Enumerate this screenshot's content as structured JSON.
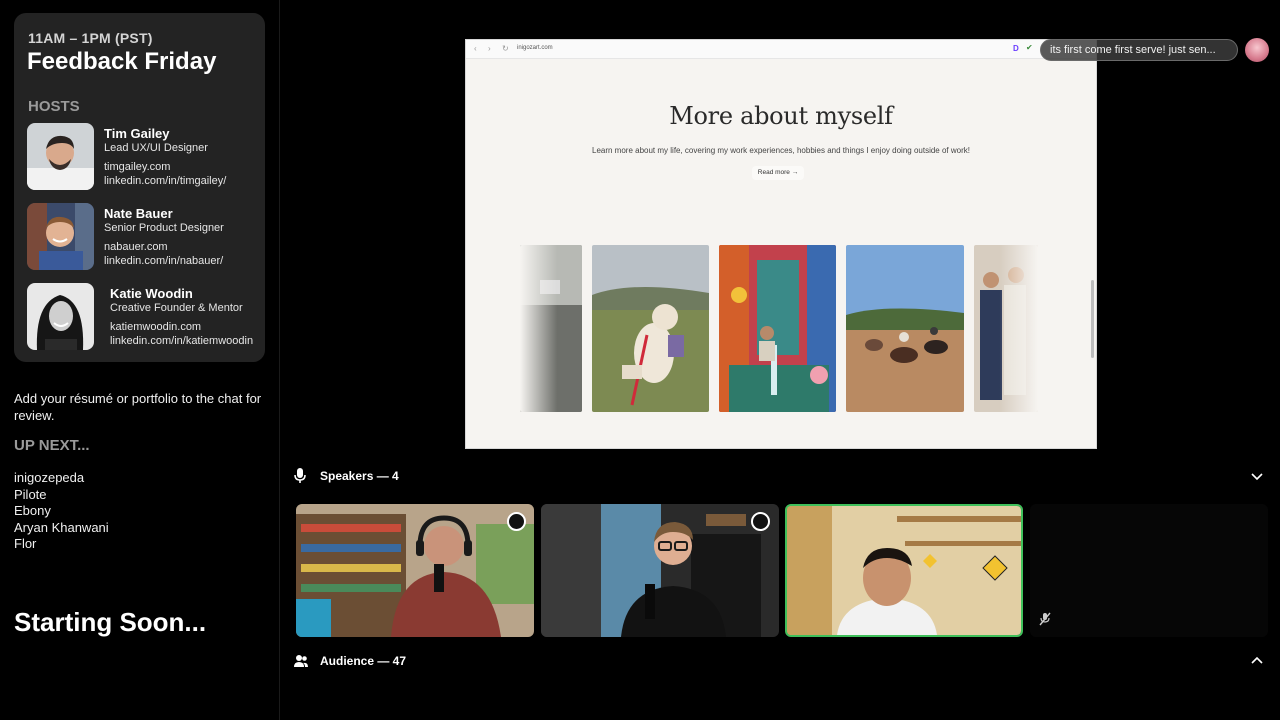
{
  "event": {
    "time": "11AM – 1PM (PST)",
    "title": "Feedback Friday",
    "hosts_heading": "HOSTS",
    "hosts": [
      {
        "name": "Tim Gailey",
        "role": "Lead UX/UI Designer",
        "site": "timgailey.com",
        "linkedin": "linkedin.com/in/timgailey/"
      },
      {
        "name": "Nate Bauer",
        "role": "Senior Product Designer",
        "site": "nabauer.com",
        "linkedin": "linkedin.com/in/nabauer/"
      },
      {
        "name": "Katie Woodin",
        "role": "Creative Founder & Mentor",
        "site": "katiemwoodin.com",
        "linkedin": "linkedin.com/in/katiemwoodin"
      }
    ],
    "note": "Add your résumé or portfolio to the chat for review.",
    "up_next_heading": "UP NEXT...",
    "up_next": [
      "inigozepeda",
      "Pilote",
      "Ebony",
      "Aryan Khanwani",
      "Flor"
    ],
    "status": "Starting Soon..."
  },
  "share": {
    "url": "inigozart.com",
    "heading": "More about myself",
    "subtext": "Learn more about my life, covering my work experiences, hobbies and things I enjoy doing outside of work!",
    "read_more": "Read more →",
    "ext_label": "D"
  },
  "chat": {
    "message": "its first come first serve! just sen..."
  },
  "speakers": {
    "label": "Speakers — 4",
    "active_border": "#3fbf5a"
  },
  "audience": {
    "label": "Audience — 47"
  },
  "icons": {
    "mic": "microphone-icon",
    "audience": "people-icon",
    "muted": "muted-mic-icon",
    "badge": "moderator-shield-icon"
  }
}
